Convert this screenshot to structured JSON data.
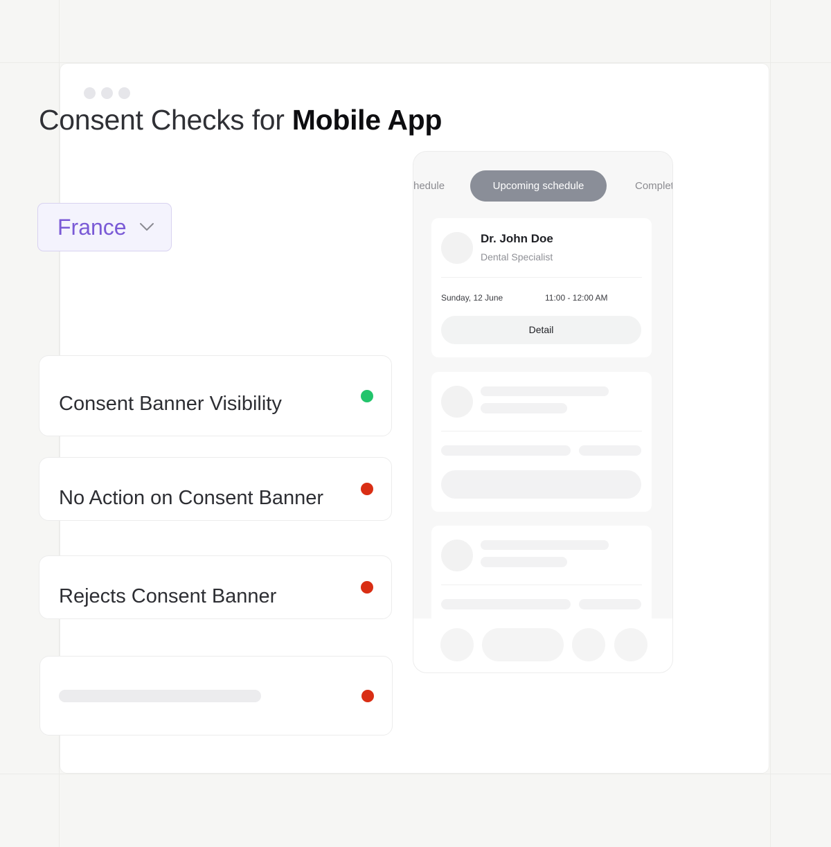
{
  "page": {
    "title_prefix": "Consent Checks for",
    "title_emphasis": "Mobile App"
  },
  "country_selector": {
    "value": "France",
    "icon": "chevron-down-icon",
    "accent_color": "#7a5ad6"
  },
  "checks": [
    {
      "label": "Consent Banner Visibility",
      "status": "pass",
      "color": "#22c46b"
    },
    {
      "label": "No Action on Consent Banner",
      "status": "fail",
      "color": "#d92e14"
    },
    {
      "label": "Rejects Consent Banner",
      "status": "fail",
      "color": "#d92e14"
    },
    {
      "label": "",
      "status": "fail",
      "color": "#d92e14"
    }
  ],
  "phone": {
    "tabs": {
      "left": "hedule",
      "active": "Upcoming schedule",
      "right": "Complet"
    },
    "appointment": {
      "doctor": "Dr. John Doe",
      "specialty": "Dental Specialist",
      "date": "Sunday, 12 June",
      "time": "11:00 - 12:00 AM",
      "button_label": "Detail"
    }
  }
}
